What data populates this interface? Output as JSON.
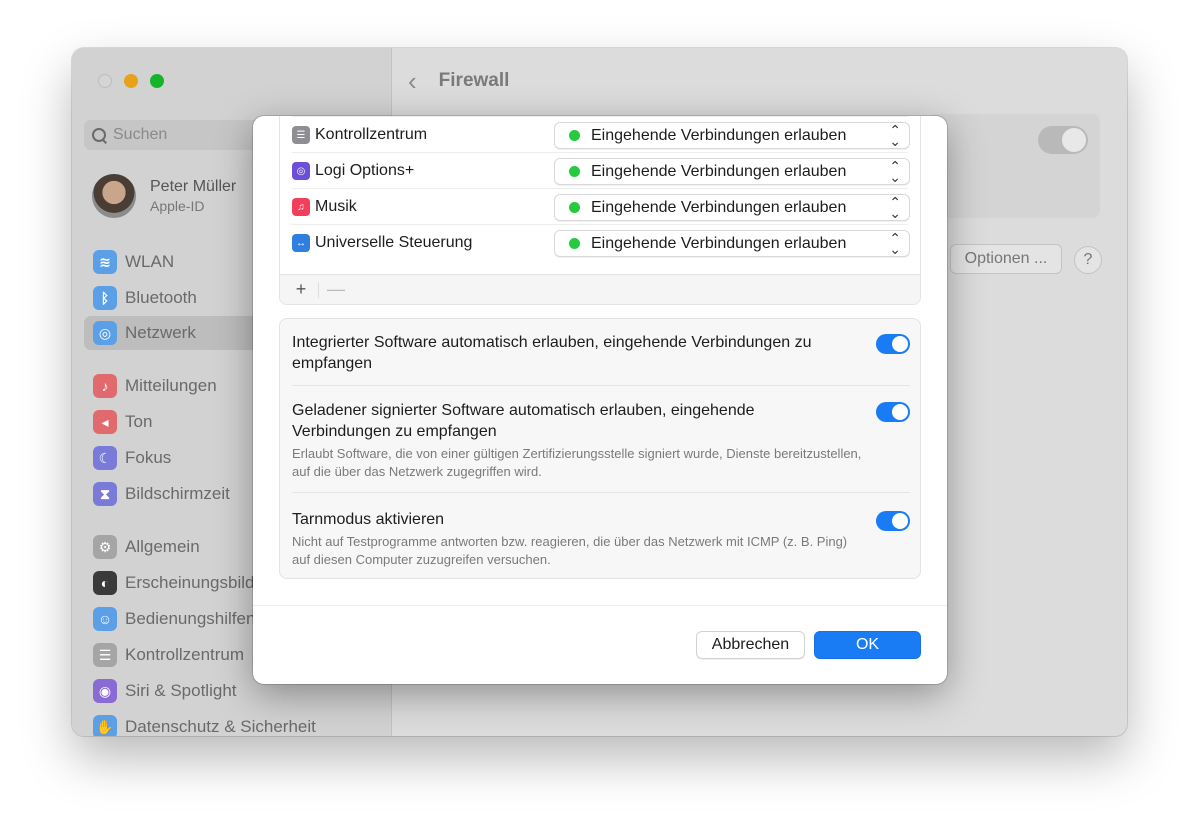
{
  "window": {
    "title": "Firewall",
    "search_placeholder": "Suchen"
  },
  "profile": {
    "name": "Peter Müller",
    "subtitle": "Apple-ID"
  },
  "sidebar": {
    "items": [
      {
        "label": "WLAN",
        "icon": "wifi-icon",
        "color": "#3a8fe8"
      },
      {
        "label": "Bluetooth",
        "icon": "bluetooth-icon",
        "color": "#3a8fe8"
      },
      {
        "label": "Netzwerk",
        "icon": "globe-icon",
        "color": "#3a8fe8",
        "active": true
      },
      {
        "label": "Mitteilungen",
        "icon": "bell-icon",
        "color": "#e5484d"
      },
      {
        "label": "Ton",
        "icon": "speaker-icon",
        "color": "#e5484d"
      },
      {
        "label": "Fokus",
        "icon": "moon-icon",
        "color": "#5a5bd6"
      },
      {
        "label": "Bildschirmzeit",
        "icon": "hourglass-icon",
        "color": "#5a5bd6"
      },
      {
        "label": "Allgemein",
        "icon": "gear-icon",
        "color": "#9a9a9a"
      },
      {
        "label": "Erscheinungsbild",
        "icon": "appearance-icon",
        "color": "#2a2a2a"
      },
      {
        "label": "Bedienungshilfen",
        "icon": "accessibility-icon",
        "color": "#3a8fe8"
      },
      {
        "label": "Kontrollzentrum",
        "icon": "control-center-icon",
        "color": "#9a9a9a"
      },
      {
        "label": "Siri & Spotlight",
        "icon": "siri-icon",
        "color": "#7a57d1"
      },
      {
        "label": "Datenschutz & Sicherheit",
        "icon": "hand-icon",
        "color": "#3a8fe8"
      }
    ]
  },
  "background": {
    "options_label": "Optionen ...",
    "help_label": "?"
  },
  "apps": [
    {
      "name": "Kontrollzentrum",
      "icon": "control-center-icon",
      "color": "#8e8e93",
      "state": "Eingehende Verbindungen erlauben"
    },
    {
      "name": "Logi Options+",
      "icon": "logi-icon",
      "color": "#6d4ed8",
      "state": "Eingehende Verbindungen erlauben"
    },
    {
      "name": "Musik",
      "icon": "music-icon",
      "color": "#f33f5c",
      "state": "Eingehende Verbindungen erlauben"
    },
    {
      "name": "Universelle Steuerung",
      "icon": "universal-control-icon",
      "color": "#2e7fe0",
      "state": "Eingehende Verbindungen erlauben"
    }
  ],
  "table_footer": {
    "add": "+",
    "remove": "—"
  },
  "options": [
    {
      "label": "Integrierter Software automatisch erlauben, eingehende Verbindungen zu empfangen",
      "description": "",
      "enabled": true
    },
    {
      "label": "Geladener signierter Software automatisch erlauben, eingehende Verbindungen zu empfangen",
      "description": "Erlaubt Software, die von einer gültigen Zertifizierungsstelle signiert wurde, Dienste bereitzustellen, auf die über das Netzwerk zugegriffen wird.",
      "enabled": true
    },
    {
      "label": "Tarnmodus aktivieren",
      "description": "Nicht auf Testprogramme antworten bzw. reagieren, die über das Netzwerk mit ICMP (z. B. Ping) auf diesen Computer zuzugreifen versuchen.",
      "enabled": true
    }
  ],
  "buttons": {
    "cancel": "Abbrechen",
    "ok": "OK"
  },
  "colors": {
    "accent": "#1a7cf5",
    "allow_dot": "#28c840"
  }
}
